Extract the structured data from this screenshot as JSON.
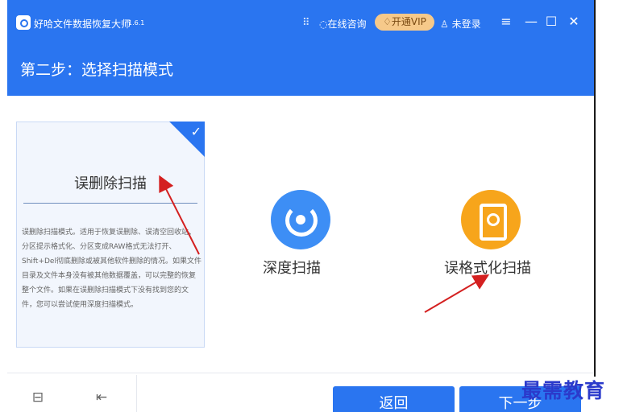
{
  "app": {
    "name": "好哈文件数据恢复大师",
    "version": "1.6.1",
    "chat_label": "在线咨询",
    "vip_label": "开通VIP",
    "user_label": "未登录",
    "grid_icon": "grid-icon",
    "menu_icon": "≡",
    "minimize_icon": "—",
    "maximize_icon": "☐",
    "close_icon": "✕"
  },
  "header": {
    "title": "第二步：选择扫描模式"
  },
  "modes": [
    {
      "title": "误删除扫描",
      "selected": true,
      "description": "误删除扫描模式。适用于恢复误删除、误清空回收站、分区提示格式化、分区变成RAW格式无法打开、Shift+Del彻底删除或被其他软件删除的情况。如果文件目录及文件本身没有被其他数据覆盖，可以完整的恢复整个文件。如果在误删除扫描模式下没有找到您的文件，您可以尝试使用深度扫描模式。"
    },
    {
      "title": "深度扫描",
      "icon": "radar-icon",
      "color": "#3d8ef5"
    },
    {
      "title": "误格式化扫描",
      "icon": "hard-disk-icon",
      "color": "#f7a51b"
    }
  ],
  "footer": {
    "back_label": "返回",
    "next_label": "下一步"
  },
  "watermark": "最需教育",
  "colors": {
    "primary": "#2a75f0",
    "vip": "#f6c98a",
    "annotation": "#d42020"
  }
}
